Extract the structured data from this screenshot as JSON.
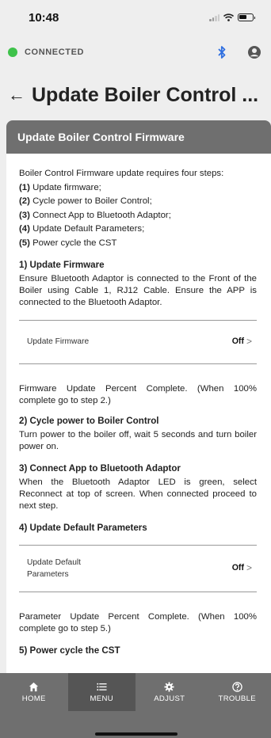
{
  "status_bar": {
    "time": "10:48"
  },
  "connection": {
    "status": "CONNECTED",
    "color": "#3ec24a"
  },
  "header": {
    "title": "Update Boiler Control ..."
  },
  "card": {
    "header": "Update Boiler Control Firmware",
    "intro": "Boiler Control Firmware update requires four steps:",
    "steps": [
      {
        "num": "(1)",
        "text": " Update firmware;"
      },
      {
        "num": "(2)",
        "text": " Cycle power to Boiler Control;"
      },
      {
        "num": "(3)",
        "text": " Connect App to Bluetooth Adaptor;"
      },
      {
        "num": "(4)",
        "text": " Update Default Parameters;"
      },
      {
        "num": "(5)",
        "text": " Power cycle the CST"
      }
    ],
    "section1": {
      "title": "1) Update Firmware",
      "text": "Ensure Bluetooth Adaptor is connected to the Front of the Boiler using Cable 1, RJ12 Cable. Ensure the APP is connected to the Bluetooth Adaptor."
    },
    "firmware_toggle": {
      "label": "Update Firmware",
      "value": "Off"
    },
    "firmware_percent": "Firmware Update Percent Complete. (When 100% complete go to step 2.)",
    "section2": {
      "title": "2) Cycle power to Boiler Control",
      "text": "Turn power to the boiler off, wait 5 seconds and turn boiler power on."
    },
    "section3": {
      "title": "3) Connect App to Bluetooth Adaptor",
      "text": "When the Bluetooth Adaptor LED is green, select Reconnect at top of screen. When connected proceed to next step."
    },
    "section4": {
      "title": "4) Update Default Parameters"
    },
    "params_toggle": {
      "label": "Update Default Parameters",
      "value": "Off"
    },
    "params_percent": "Parameter Update Percent Complete. (When 100% complete go to step 5.)",
    "section5": {
      "title": "5) Power cycle the CST"
    }
  },
  "tabs": [
    {
      "label": "HOME",
      "icon": "home-icon"
    },
    {
      "label": "MENU",
      "icon": "menu-icon",
      "active": true
    },
    {
      "label": "ADJUST",
      "icon": "gear-icon"
    },
    {
      "label": "TROUBLE",
      "icon": "help-icon"
    }
  ],
  "colors": {
    "bluetooth": "#2f6fe0",
    "card_header": "#6f6f6f",
    "tab_bar": "#6f6f6f",
    "tab_active": "#555555"
  }
}
